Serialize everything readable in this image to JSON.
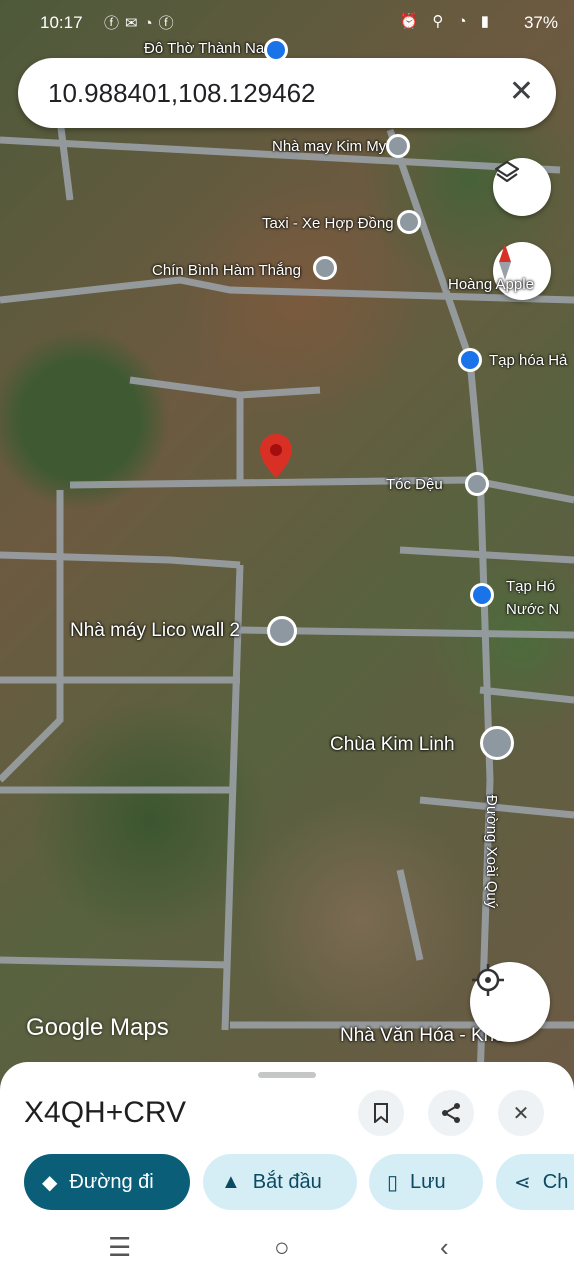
{
  "status_bar": {
    "time": "10:17",
    "battery": "37%"
  },
  "search": {
    "query": "10.988401,108.129462"
  },
  "map": {
    "labels": [
      "Đô Thờ Thành Nam",
      "Nhà may Kim My",
      "Taxi - Xe Hợp Đồng",
      "Chín Bình Hàm Thắng",
      "Hoàng Apple",
      "Tạp hóa Hả",
      "Tóc Dệu",
      "Tạp Hó",
      "Nước N",
      "Nhà máy Lico wall 2",
      "Chùa Kim Linh",
      "Đường Xoài Quý",
      "Nhà Văn Hóa - Khu T"
    ],
    "logo": "Google Maps"
  },
  "sheet": {
    "place_code": "X4QH+CRV",
    "actions": [
      "Đường đi",
      "Bắt đầu",
      "Lưu",
      "Ch"
    ]
  },
  "colors": {
    "primary": "#0b5e78",
    "chip_bg": "#d5eef6",
    "pin": "#d93025"
  }
}
